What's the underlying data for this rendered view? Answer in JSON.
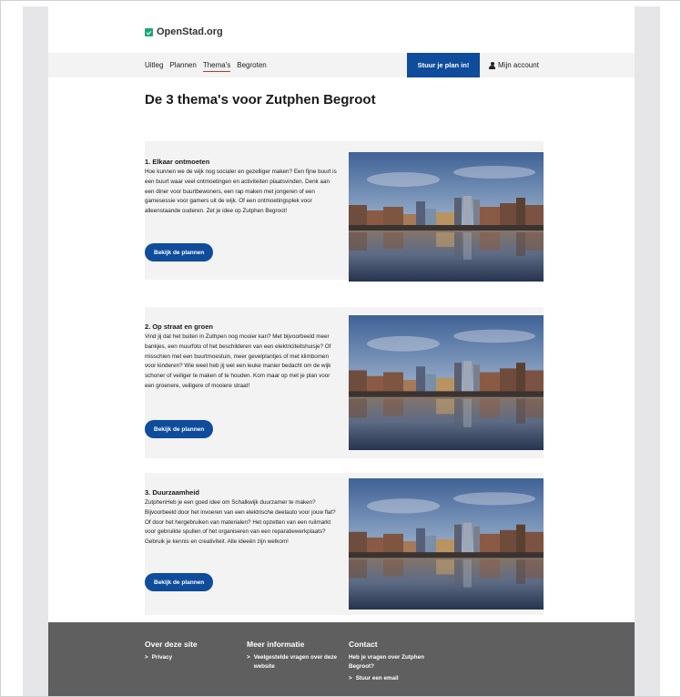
{
  "brand": {
    "name": "OpenStad.org",
    "icon": "check-square-icon",
    "color": "#1fa67a"
  },
  "nav": {
    "links": [
      "Uitleg",
      "Plannen",
      "Thema's",
      "Begroten"
    ],
    "active_index": 2,
    "cta": "Stuur je plan in!",
    "account": "Mijn account"
  },
  "page_title": "De 3 thema's voor Zutphen Begroot",
  "themes": [
    {
      "title": "1. Elkaar ontmoeten",
      "description": "Hoe kunnen we de wijk nog socialer en gezelliger maken? Een fijne buurt is een buurt waar veel ontmoetingen en activiteiten plaatsvinden. Denk aan een diner voor buurtbewoners, een rap maken met jongeren of een gamesessie voor gamers uit de wijk. Of een ontmoetingsplek voor alleenstaande ouderen. Zet je idee op Zutphen Begroot!",
      "button": "Bekijk de plannen"
    },
    {
      "title": "2. Op straat en groen",
      "description": "Vind jij dat het buiten in Zuthpen nog mooier kan? Met bijvoorbeeld meer bankjes, een muurfoto of het beschilderen van een elektriciteitshuisje? Of misschien met een buurtmoestuin, meer gevelplantjes of met klimbomen voor kinderen? Wie weet heb jij wel een leuke manier bedacht om de wijk schoner of veiliger te maken of te houden. Kom maar op met je plan voor een groenere, veiligere of mooiere straat!",
      "button": "Bekijk de plannen"
    },
    {
      "title": "3. Duurzaamheid",
      "description": "ZutphenHeb je een goed idee om Schalkwijk duurzamer te maken? Bijvoorbeeld door het invoeren van een elektrische deelauto voor jouw flat? Of door het hergebruiken van materialen? Het opzetten van een ruilmarkt voor gebruikte spullen of het organiseren van een reparatiewerkplaats? Gebruik je kennis en creativiteit. Alle ideeën zijn welkom!",
      "button": "Bekijk de plannen"
    }
  ],
  "footer": {
    "about": {
      "heading": "Over deze site",
      "links": [
        "Privacy"
      ]
    },
    "more": {
      "heading": "Meer informatie",
      "links": [
        "Veelgestelde vragen over deze website"
      ]
    },
    "contact": {
      "heading": "Contact",
      "text": "Heb je vragen over Zutphen Begroot?",
      "links": [
        "Stuur een email"
      ]
    }
  },
  "colors": {
    "primary": "#0f4c9b",
    "active_underline": "#c0392b",
    "footer_bg": "#5f5f5f",
    "card_bg": "#f3f3f3"
  }
}
